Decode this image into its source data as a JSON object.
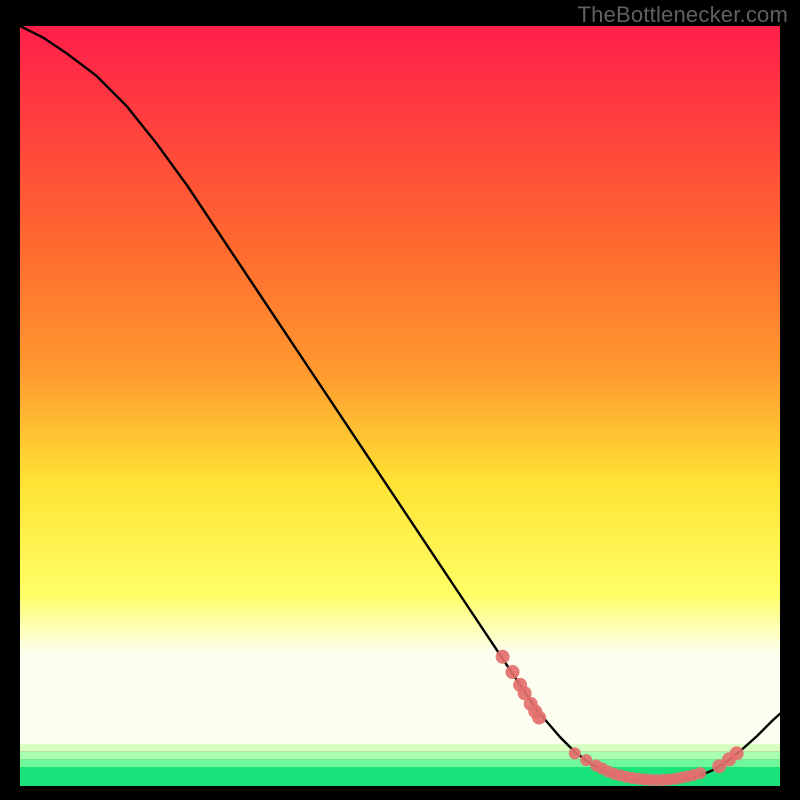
{
  "watermark": "TheBottlenecker.com",
  "chart_data": {
    "type": "line",
    "title": "",
    "xlabel": "",
    "ylabel": "",
    "xlim": [
      0,
      100
    ],
    "ylim": [
      0,
      100
    ],
    "background_gradient": {
      "top": "#ff1f4a",
      "mid_upper": "#ff9a2f",
      "mid": "#ffe334",
      "mid_lower": "#f8ff80",
      "band_pale": "#fcfff0",
      "band_green": "#19e37a"
    },
    "series": [
      {
        "name": "curve",
        "type": "line",
        "color": "#000000",
        "x": [
          0,
          3,
          6,
          10,
          14,
          18,
          22,
          26,
          30,
          34,
          38,
          42,
          46,
          50,
          54,
          58,
          62,
          64,
          66,
          68,
          71,
          73,
          75,
          77,
          79,
          81,
          83,
          85,
          87,
          89,
          91,
          93,
          95,
          97,
          99,
          100
        ],
        "y": [
          100,
          98.5,
          96.5,
          93.5,
          89.5,
          84.5,
          79,
          73,
          67,
          61,
          55,
          49,
          43,
          37,
          31,
          25,
          19,
          16,
          13,
          10,
          6.5,
          4.5,
          3,
          1.9,
          1.2,
          0.8,
          0.6,
          0.6,
          0.8,
          1.2,
          2,
          3.2,
          4.8,
          6.6,
          8.6,
          9.5
        ]
      },
      {
        "name": "cluster-left",
        "type": "scatter",
        "color": "#e46f6c",
        "radius": 7,
        "x": [
          63.5,
          64.8,
          65.8,
          66.4,
          67.2,
          67.8,
          68.3
        ],
        "y": [
          17.0,
          15.0,
          13.3,
          12.2,
          10.8,
          9.8,
          9.0
        ]
      },
      {
        "name": "cluster-bottom",
        "type": "scatter",
        "color": "#e46f6c",
        "radius": 6,
        "x": [
          73.0,
          74.5,
          75.8,
          76.6,
          77.4,
          78.2,
          79.0,
          79.8,
          80.6,
          81.4,
          82.2,
          83.0,
          83.8,
          84.6,
          85.4,
          86.2,
          87.0,
          87.8,
          88.6,
          89.5
        ],
        "y": [
          4.3,
          3.4,
          2.7,
          2.3,
          1.9,
          1.6,
          1.4,
          1.2,
          1.05,
          0.95,
          0.85,
          0.8,
          0.78,
          0.8,
          0.85,
          0.95,
          1.1,
          1.25,
          1.45,
          1.7
        ]
      },
      {
        "name": "cluster-right",
        "type": "scatter",
        "color": "#e46f6c",
        "radius": 7,
        "x": [
          92.0,
          93.3,
          94.3
        ],
        "y": [
          2.6,
          3.5,
          4.3
        ]
      }
    ]
  }
}
